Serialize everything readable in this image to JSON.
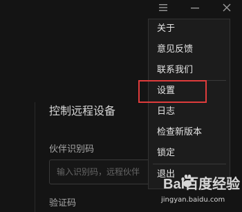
{
  "titlebar": {
    "menu_icon": "hamburger-menu-icon",
    "minimize_icon": "minimize-icon",
    "close_icon": "close-icon"
  },
  "panel": {
    "title": "控制远程设备",
    "partner_id_label": "伙伴识别码",
    "partner_id_placeholder": "输入识别码，远程伙伴",
    "verify_label": "验证码"
  },
  "menu": {
    "items": [
      {
        "label": "关于"
      },
      {
        "label": "意见反馈"
      },
      {
        "label": "联系我们"
      },
      {
        "label": "设置",
        "highlighted": true
      },
      {
        "label": "日志"
      },
      {
        "label": "检查新版本"
      },
      {
        "label": "锁定"
      },
      {
        "label": "退出"
      }
    ]
  },
  "highlight_color": "#e03c3c",
  "watermark": {
    "brand": "Bai百度经验",
    "url": "jingyan.baidu.com"
  }
}
